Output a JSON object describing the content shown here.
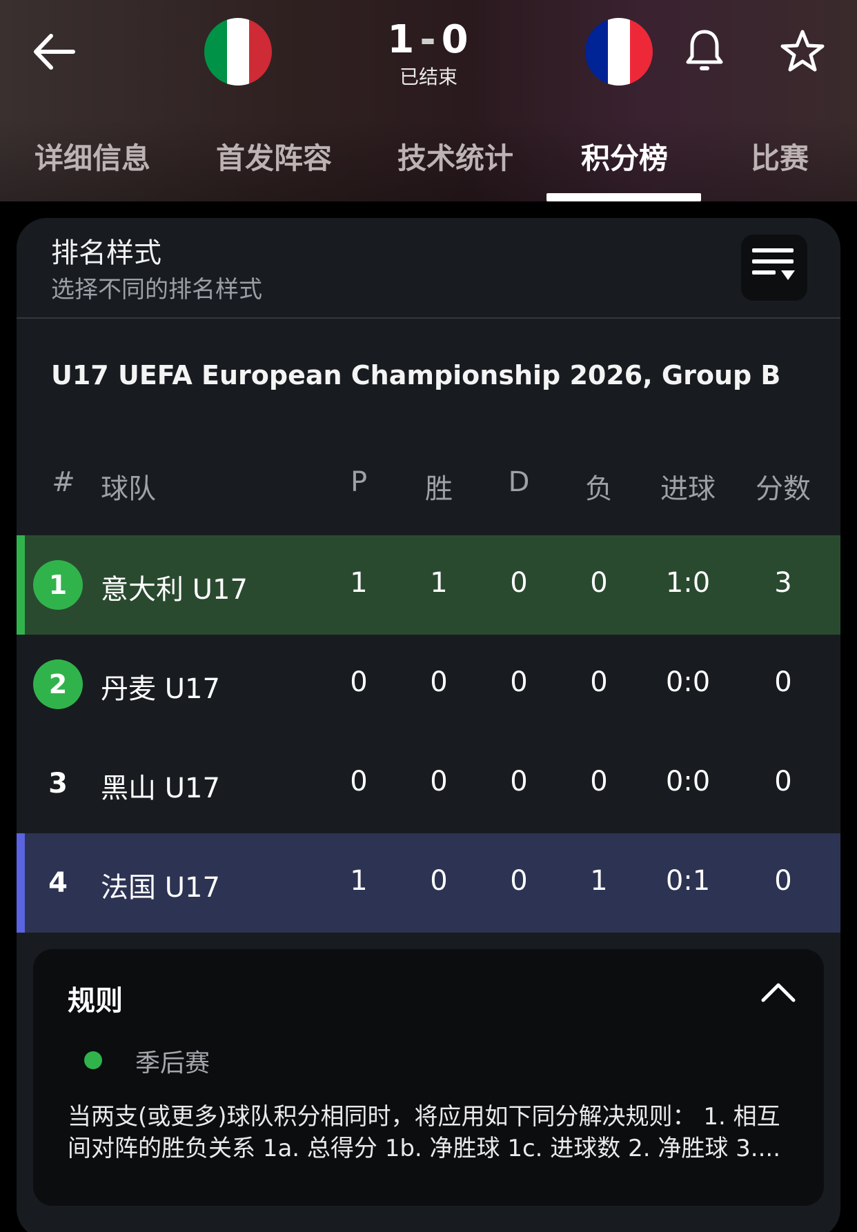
{
  "header": {
    "home_flag": [
      "#009246",
      "#ffffff",
      "#ce2b37"
    ],
    "away_flag": [
      "#002395",
      "#ffffff",
      "#ed2939"
    ],
    "score_home": "1",
    "score_away": "0",
    "score_sep": "-",
    "status": "已结束"
  },
  "tabs": [
    {
      "label": "详细信息"
    },
    {
      "label": "首发阵容"
    },
    {
      "label": "技术统计"
    },
    {
      "label": "积分榜",
      "active": true
    },
    {
      "label": "比赛"
    }
  ],
  "rank_style": {
    "title": "排名样式",
    "subtitle": "选择不同的排名样式"
  },
  "group_title": "U17 UEFA European Championship 2026, Group B",
  "table": {
    "headers": [
      "#",
      "球队",
      "P",
      "胜",
      "D",
      "负",
      "进球",
      "分数"
    ],
    "rows": [
      {
        "rank": "1",
        "team": "意大利 U17",
        "p": "1",
        "w": "1",
        "d": "0",
        "l": "0",
        "goals": "1:0",
        "pts": "3"
      },
      {
        "rank": "2",
        "team": "丹麦 U17",
        "p": "0",
        "w": "0",
        "d": "0",
        "l": "0",
        "goals": "0:0",
        "pts": "0"
      },
      {
        "rank": "3",
        "team": "黑山 U17",
        "p": "0",
        "w": "0",
        "d": "0",
        "l": "0",
        "goals": "0:0",
        "pts": "0"
      },
      {
        "rank": "4",
        "team": "法国 U17",
        "p": "1",
        "w": "0",
        "d": "0",
        "l": "1",
        "goals": "0:1",
        "pts": "0"
      }
    ]
  },
  "colors": {
    "qualify": "#31b34c",
    "highlight_row": "#5a63e0"
  },
  "rules": {
    "title": "规则",
    "legend": "季后赛",
    "text": "当两支(或更多)球队积分相同时，将应用如下同分解决规则： 1. 相互间对阵的胜负关系 1a. 总得分 1b. 净胜球 1c. 进球数 2. 净胜球 3...."
  }
}
